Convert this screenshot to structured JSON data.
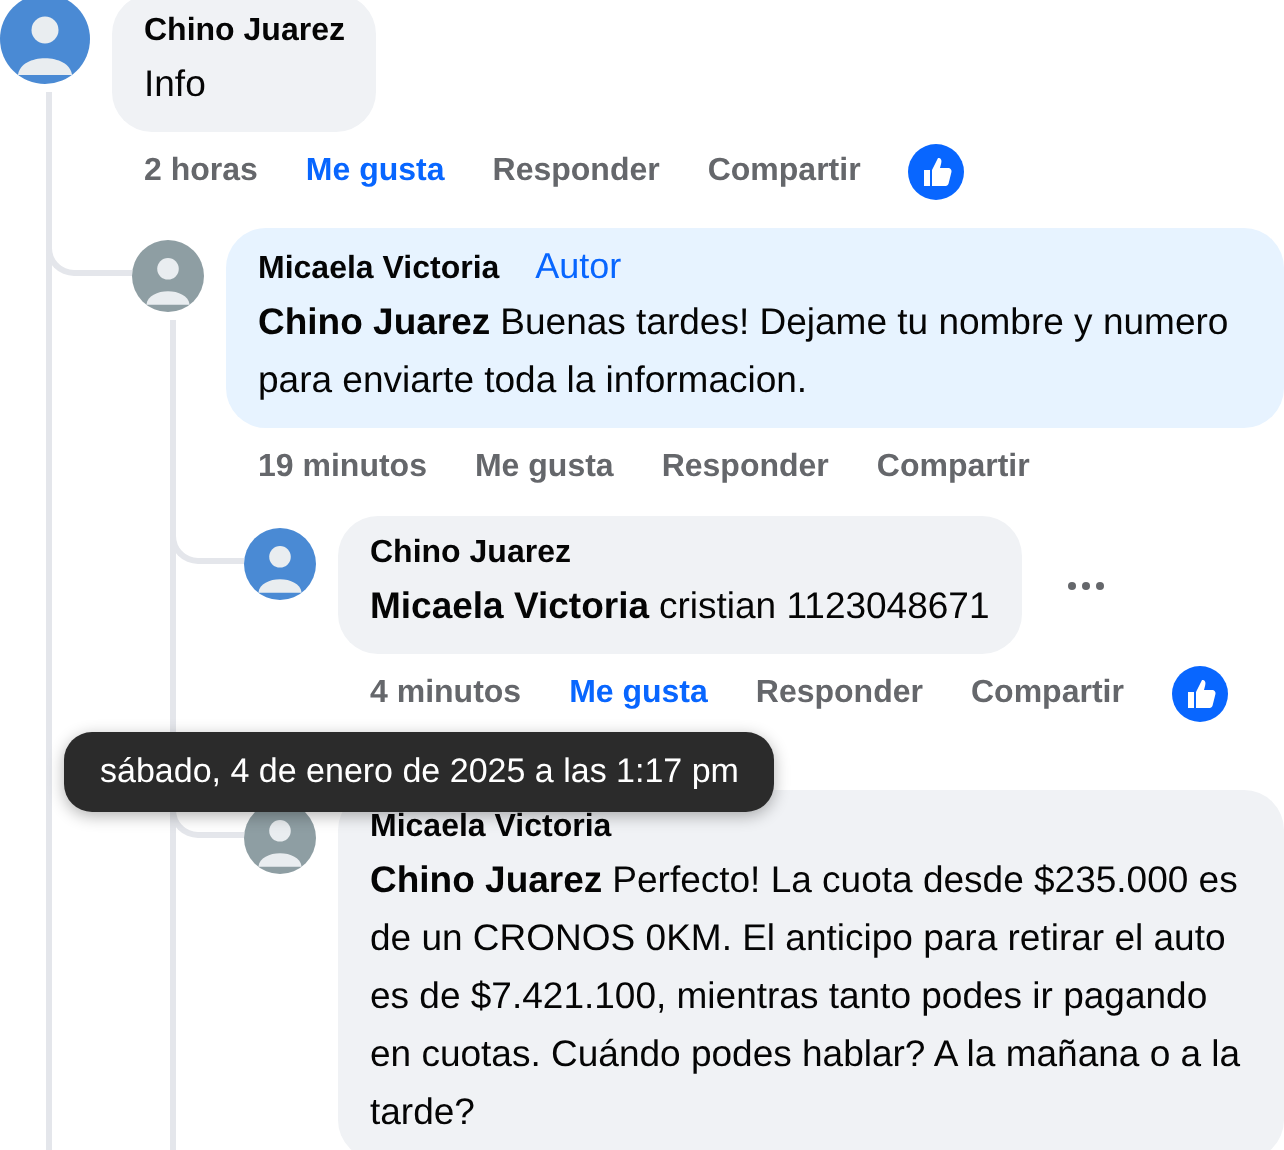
{
  "comments": [
    {
      "author": "Chino Juarez",
      "color": "#4a8ad4",
      "text": "Info",
      "time": "2 horas",
      "liked": true,
      "actions": [
        "Me gusta",
        "Responder",
        "Compartir"
      ],
      "reaction": true,
      "replies": [
        {
          "author": "Micaela Victoria",
          "color": "#8e9ea3",
          "author_badge": "Autor",
          "mention": "Chino Juarez",
          "text": "Buenas tardes! Dejame tu nombre y numero para enviarte toda la informacion.",
          "time": "19 minutos",
          "liked": false,
          "actions": [
            "Me gusta",
            "Responder",
            "Compartir"
          ],
          "replies": [
            {
              "author": "Chino Juarez",
              "color": "#4a8ad4",
              "mention": "Micaela Victoria",
              "text": "cristian 1123048671",
              "more_button": true,
              "time": "4 minutos",
              "liked": true,
              "actions": [
                "Me gusta",
                "Responder",
                "Compartir"
              ],
              "reaction": true
            },
            {
              "author": "Micaela Victoria",
              "color": "#8e9ea3",
              "mention": "Chino Juarez",
              "text": "Perfecto! La cuota desde $235.000 es de un CRONOS 0KM. El anticipo para retirar el auto es de $7.421.100, mientras tanto podes ir pagando en cuotas. Cuándo podes hablar? A la mañana o a la tarde?"
            }
          ]
        }
      ]
    }
  ],
  "tooltip": {
    "text": "sábado, 4 de enero de 2025 a las 1:17 pm"
  }
}
